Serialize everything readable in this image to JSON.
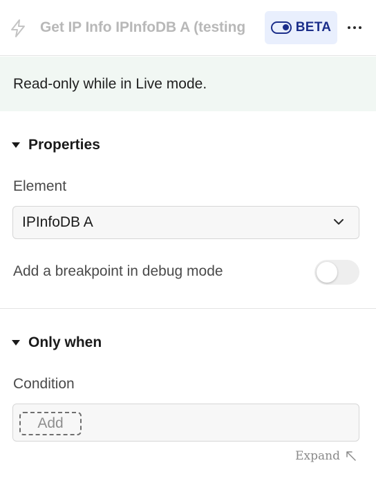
{
  "header": {
    "title": "Get IP Info IPInfoDB A (testing",
    "beta_label": "BETA",
    "icon_action": "bolt-icon",
    "icon_more": "more-horizontal-icon"
  },
  "notice": {
    "text": "Read-only while in Live mode.",
    "background": "#f1f7f3"
  },
  "properties": {
    "heading": "Properties",
    "element_label": "Element",
    "element_value": "IPInfoDB A",
    "breakpoint_label": "Add a breakpoint in debug mode",
    "breakpoint_enabled": false
  },
  "only_when": {
    "heading": "Only when",
    "condition_label": "Condition",
    "add_label": "Add",
    "expand_label": "Expand"
  },
  "colors": {
    "beta_text": "#1b2e8a",
    "beta_bg": "#e9effd"
  }
}
